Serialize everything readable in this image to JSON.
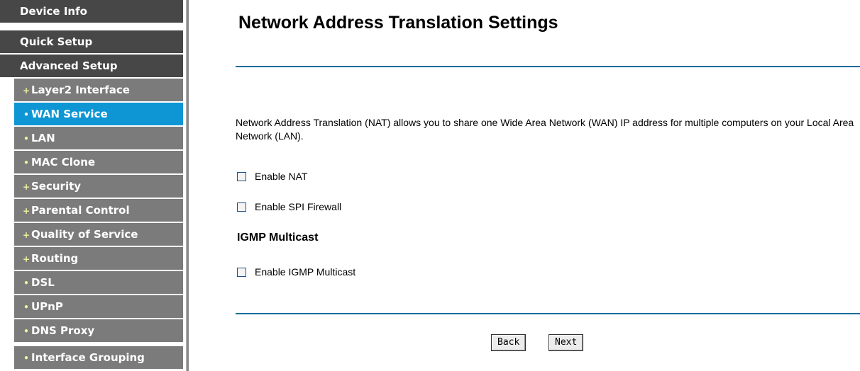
{
  "sidebar": {
    "items": [
      {
        "label": "Device Info",
        "level": "top",
        "bullet": ""
      },
      {
        "label": "Quick Setup",
        "level": "top",
        "bullet": ""
      },
      {
        "label": "Advanced Setup",
        "level": "top",
        "bullet": ""
      },
      {
        "label": "Layer2 Interface",
        "level": "sub",
        "bullet": "+"
      },
      {
        "label": "WAN Service",
        "level": "sub",
        "bullet": "•",
        "active": true
      },
      {
        "label": "LAN",
        "level": "sub",
        "bullet": "•"
      },
      {
        "label": "MAC Clone",
        "level": "sub",
        "bullet": "•"
      },
      {
        "label": "Security",
        "level": "sub",
        "bullet": "+"
      },
      {
        "label": "Parental Control",
        "level": "sub",
        "bullet": "+"
      },
      {
        "label": "Quality of Service",
        "level": "sub",
        "bullet": "+"
      },
      {
        "label": "Routing",
        "level": "sub",
        "bullet": "+"
      },
      {
        "label": "DSL",
        "level": "sub",
        "bullet": "•"
      },
      {
        "label": "UPnP",
        "level": "sub",
        "bullet": "•"
      },
      {
        "label": "DNS Proxy",
        "level": "sub",
        "bullet": "•"
      },
      {
        "label": "Interface Grouping",
        "level": "sub",
        "bullet": "•"
      }
    ]
  },
  "main": {
    "title": "Network Address Translation Settings",
    "description": "Network Address Translation (NAT) allows you to share one Wide Area Network (WAN) IP address for multiple computers on your Local Area Network (LAN).",
    "options": {
      "enable_nat": {
        "label": "Enable NAT",
        "checked": false
      },
      "enable_spi_firewall": {
        "label": "Enable SPI Firewall",
        "checked": false
      },
      "igmp_heading": "IGMP Multicast",
      "enable_igmp": {
        "label": "Enable IGMP Multicast",
        "checked": false
      }
    },
    "buttons": {
      "back": "Back",
      "next": "Next"
    }
  },
  "colors": {
    "sidebar_top": "#474747",
    "sidebar_sub": "#7b7b7b",
    "sidebar_active": "#0e96d4",
    "rule": "#1b6b9e"
  }
}
